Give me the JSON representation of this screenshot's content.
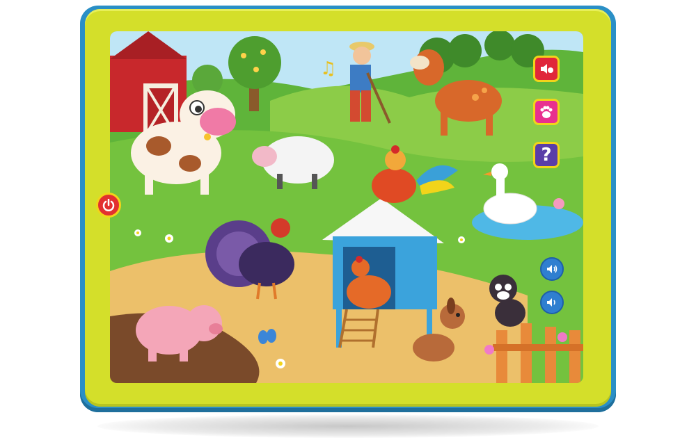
{
  "device": {
    "frame_color": "#d4df2a",
    "rim_color": "#2a8fc6"
  },
  "scene": {
    "description_icons": [
      "barn",
      "cow",
      "sheep",
      "farmer",
      "horse",
      "rooster",
      "turkey",
      "goose",
      "chicken-coop",
      "hen",
      "cat",
      "dog",
      "pig",
      "butterfly",
      "fence",
      "flowers"
    ]
  },
  "buttons": {
    "animal_sounds_icon": "speaker-bird-icon",
    "animals_icon": "paw-icon",
    "help_label": "?",
    "power_icon": "power-icon",
    "volume_up_icon": "volume-up-icon",
    "volume_down_icon": "volume-down-icon"
  },
  "colors": {
    "sound_button": "#e0263a",
    "paw_button": "#e8308f",
    "help_button": "#5a3ea8",
    "power_button": "#e23030",
    "volume_button": "#2f7fd0"
  },
  "music_note": "♫"
}
